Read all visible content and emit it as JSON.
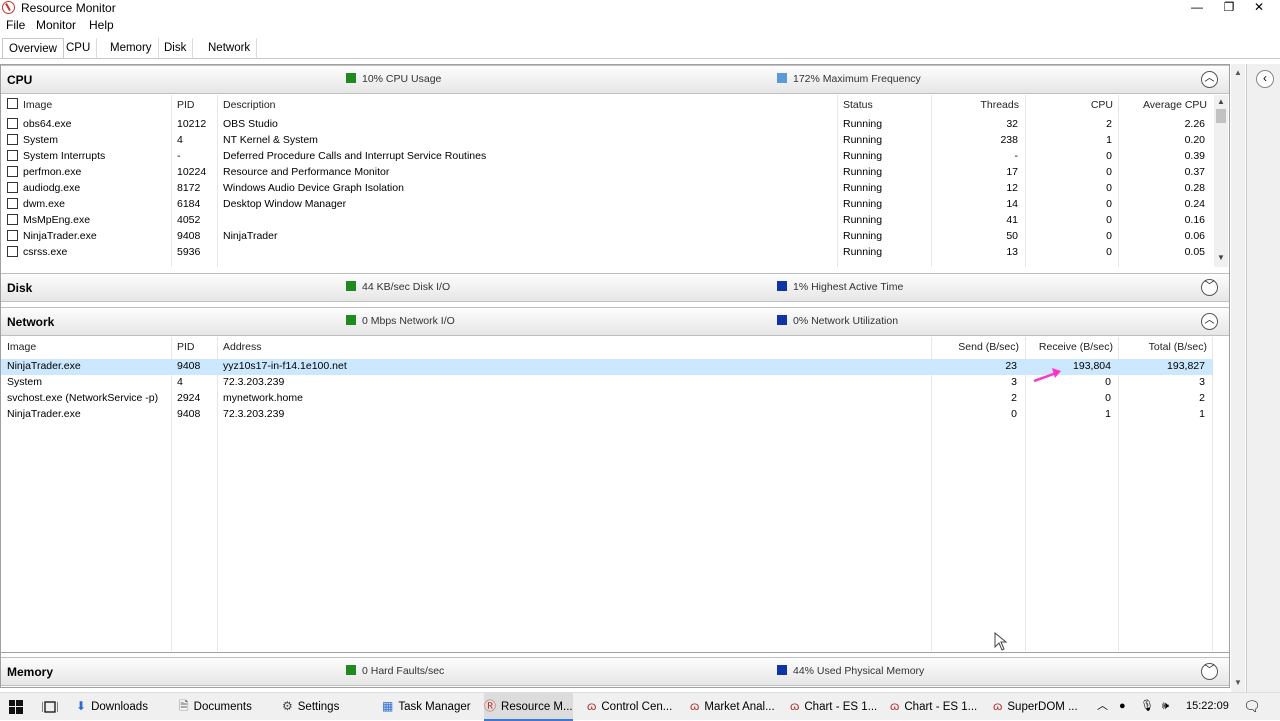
{
  "window": {
    "title": "Resource Monitor",
    "min": "—",
    "max": "❐",
    "close": "✕"
  },
  "menu": [
    "File",
    "Monitor",
    "Help"
  ],
  "tabs": [
    "Overview",
    "CPU",
    "Memory",
    "Disk",
    "Network"
  ],
  "colors": {
    "cpu_usage": "#1f8a1f",
    "max_freq": "#5b9bd5",
    "disk_io": "#1f8a1f",
    "active_time": "#1133aa",
    "selection": "#cce8ff",
    "arrow": "#ff33cc"
  },
  "cpu": {
    "name": "CPU",
    "stat1": "10% CPU Usage",
    "stat2": "172% Maximum Frequency",
    "columns": [
      "Image",
      "PID",
      "Description",
      "Status",
      "Threads",
      "CPU",
      "Average CPU"
    ],
    "rows": [
      {
        "image": "obs64.exe",
        "pid": "10212",
        "desc": "OBS Studio",
        "status": "Running",
        "threads": "32",
        "cpu": "2",
        "avg": "2.26"
      },
      {
        "image": "System",
        "pid": "4",
        "desc": "NT Kernel & System",
        "status": "Running",
        "threads": "238",
        "cpu": "1",
        "avg": "0.20"
      },
      {
        "image": "System Interrupts",
        "pid": "-",
        "desc": "Deferred Procedure Calls and Interrupt Service Routines",
        "status": "Running",
        "threads": "-",
        "cpu": "0",
        "avg": "0.39"
      },
      {
        "image": "perfmon.exe",
        "pid": "10224",
        "desc": "Resource and Performance Monitor",
        "status": "Running",
        "threads": "17",
        "cpu": "0",
        "avg": "0.37"
      },
      {
        "image": "audiodg.exe",
        "pid": "8172",
        "desc": "Windows Audio Device Graph Isolation",
        "status": "Running",
        "threads": "12",
        "cpu": "0",
        "avg": "0.28"
      },
      {
        "image": "dwm.exe",
        "pid": "6184",
        "desc": "Desktop Window Manager",
        "status": "Running",
        "threads": "14",
        "cpu": "0",
        "avg": "0.24"
      },
      {
        "image": "MsMpEng.exe",
        "pid": "4052",
        "desc": "",
        "status": "Running",
        "threads": "41",
        "cpu": "0",
        "avg": "0.16"
      },
      {
        "image": "NinjaTrader.exe",
        "pid": "9408",
        "desc": "NinjaTrader",
        "status": "Running",
        "threads": "50",
        "cpu": "0",
        "avg": "0.06"
      },
      {
        "image": "csrss.exe",
        "pid": "5936",
        "desc": "",
        "status": "Running",
        "threads": "13",
        "cpu": "0",
        "avg": "0.05"
      }
    ]
  },
  "disk": {
    "name": "Disk",
    "stat1": "44 KB/sec Disk I/O",
    "stat2": "1% Highest Active Time"
  },
  "network": {
    "name": "Network",
    "stat1": "0 Mbps Network I/O",
    "stat2": "0% Network Utilization",
    "columns": [
      "Image",
      "PID",
      "Address",
      "Send (B/sec)",
      "Receive (B/sec)",
      "Total (B/sec)"
    ],
    "rows": [
      {
        "image": "NinjaTrader.exe",
        "pid": "9408",
        "address": "yyz10s17-in-f14.1e100.net",
        "send": "23",
        "receive": "193,804",
        "total": "193,827"
      },
      {
        "image": "System",
        "pid": "4",
        "address": "72.3.203.239",
        "send": "3",
        "receive": "0",
        "total": "3"
      },
      {
        "image": "svchost.exe (NetworkService -p)",
        "pid": "2924",
        "address": "mynetwork.home",
        "send": "2",
        "receive": "0",
        "total": "2"
      },
      {
        "image": "NinjaTrader.exe",
        "pid": "9408",
        "address": "72.3.203.239",
        "send": "0",
        "receive": "1",
        "total": "1"
      }
    ]
  },
  "memory": {
    "name": "Memory",
    "stat1": "0 Hard Faults/sec",
    "stat2": "44% Used Physical Memory"
  },
  "taskbar": {
    "items": [
      "Downloads",
      "Documents",
      "Settings",
      "Task Manager",
      "Resource M...",
      "Control Cen...",
      "Market Anal...",
      "Chart - ES 1...",
      "Chart - ES 1...",
      "SuperDOM ..."
    ],
    "clock": "15:22:09"
  }
}
